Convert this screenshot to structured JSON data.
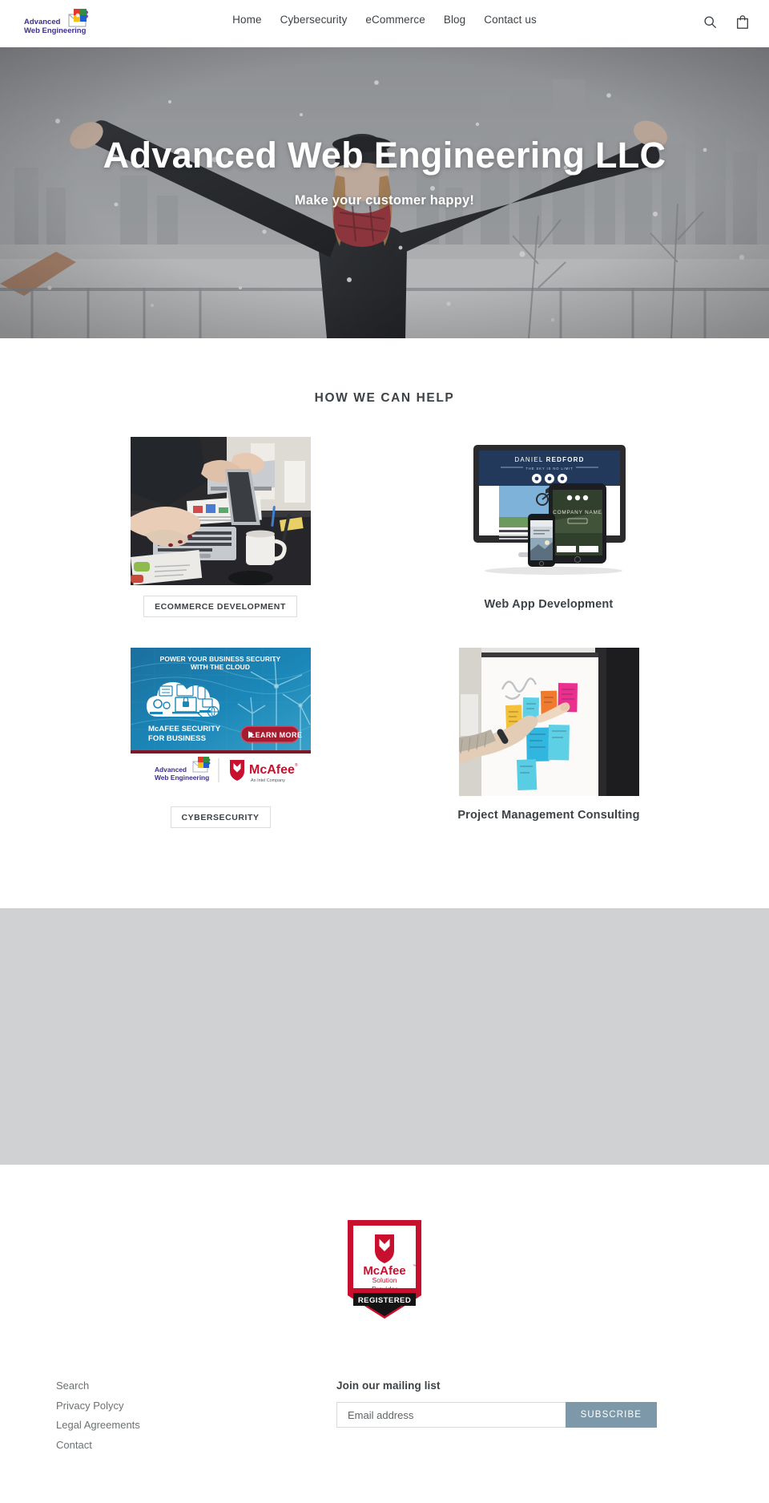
{
  "header": {
    "logo": {
      "line1": "Advanced",
      "line2": "Web Engineering",
      "icon_name": "puzzle-envelope-logo-icon"
    },
    "nav": [
      {
        "label": "Home"
      },
      {
        "label": "Cybersecurity"
      },
      {
        "label": "eCommerce"
      },
      {
        "label": "Blog"
      },
      {
        "label": "Contact us"
      }
    ],
    "search_icon": "search-icon",
    "cart_icon": "shopping-bag-icon"
  },
  "hero": {
    "title": "Advanced Web Engineering LLC",
    "subtitle": "Make your customer happy!",
    "image_alt": "person with arms raised in falling snow with city skyline"
  },
  "help": {
    "section_title": "HOW WE CAN HELP",
    "items": [
      {
        "label": "ECOMMERCE DEVELOPMENT",
        "style": "boxed",
        "image_alt": "two people typing on laptops at a desk with coffee mug and charts"
      },
      {
        "label": "Web App Development",
        "style": "plain",
        "image_alt": "responsive website mockup on desktop monitor tablet and phone",
        "mockup": {
          "brand_first": "DANIEL",
          "brand_second": "REDFORD",
          "tagline": "THE SKY IS NO LIMIT",
          "tablet_title": "COMPANY NAME"
        }
      },
      {
        "label": "CYBERSECURITY",
        "style": "boxed",
        "image_alt": "McAfee cloud security banner",
        "banner": {
          "headline": "POWER YOUR BUSINESS SECURITY WITH THE CLOUD",
          "sub_line1": "McAFEE SECURITY",
          "sub_line2": "FOR BUSINESS",
          "cta": "LEARN MORE",
          "partner_left_line1": "Advanced",
          "partner_left_line2": "Web Engineering",
          "partner_right": "McAfee",
          "partner_right_sub": "An Intel Company"
        }
      },
      {
        "label": "Project Management Consulting",
        "style": "plain",
        "image_alt": "hand pointing at colorful sticky notes on a whiteboard"
      }
    ]
  },
  "gray_block": {
    "label": ""
  },
  "badge": {
    "brand": "McAfee",
    "trademark": "™",
    "line1": "Solution",
    "line2": "Provider",
    "ribbon": "REGISTERED"
  },
  "footer": {
    "links": [
      {
        "label": "Search"
      },
      {
        "label": "Privacy Polycy"
      },
      {
        "label": "Legal Agreements"
      },
      {
        "label": "Contact"
      }
    ],
    "newsletter": {
      "title": "Join our mailing list",
      "placeholder": "Email address",
      "value": "",
      "button": "SUBSCRIBE",
      "button_color": "#7d99a9"
    }
  }
}
